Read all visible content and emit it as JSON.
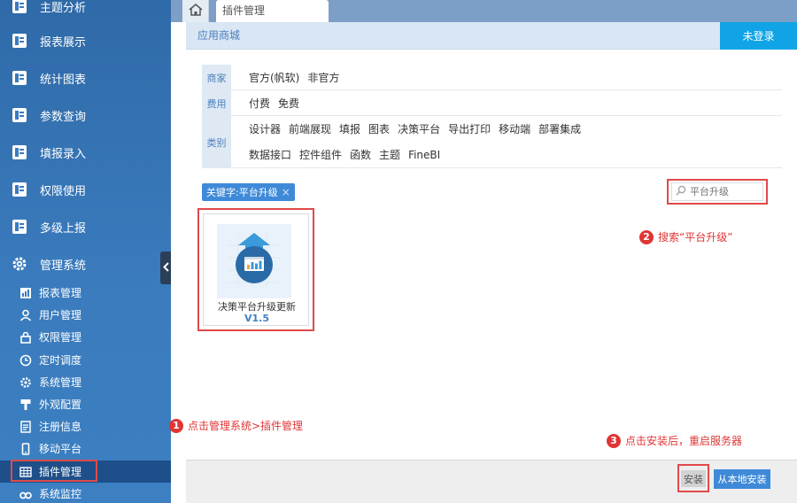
{
  "sidebar": {
    "main_items": [
      {
        "label": "主题分析",
        "icon": "report-icon"
      },
      {
        "label": "报表展示",
        "icon": "report-icon"
      },
      {
        "label": "统计图表",
        "icon": "report-icon"
      },
      {
        "label": "参数查询",
        "icon": "report-icon"
      },
      {
        "label": "填报录入",
        "icon": "report-icon"
      },
      {
        "label": "权限使用",
        "icon": "report-icon"
      },
      {
        "label": "多级上报",
        "icon": "report-icon"
      },
      {
        "label": "管理系统",
        "icon": "gear-icon"
      }
    ],
    "sub_items": [
      {
        "label": "报表管理",
        "icon": "chart-icon"
      },
      {
        "label": "用户管理",
        "icon": "user-icon"
      },
      {
        "label": "权限管理",
        "icon": "lock-icon"
      },
      {
        "label": "定时调度",
        "icon": "clock-icon"
      },
      {
        "label": "系统管理",
        "icon": "gear-icon"
      },
      {
        "label": "外观配置",
        "icon": "brush-icon"
      },
      {
        "label": "注册信息",
        "icon": "document-icon"
      },
      {
        "label": "移动平台",
        "icon": "phone-icon"
      },
      {
        "label": "插件管理",
        "icon": "grid-icon"
      },
      {
        "label": "系统监控",
        "icon": "binoculars-icon"
      }
    ],
    "active_item": "插件管理"
  },
  "tabs": {
    "home_icon": "home-icon",
    "active_tab": "插件管理"
  },
  "header": {
    "title": "应用商城",
    "login_label": "未登录"
  },
  "filters": {
    "vendor_label": "商家",
    "vendor_options": [
      "官方(帆软)",
      "非官方"
    ],
    "fee_label": "费用",
    "fee_options": [
      "付费",
      "免费"
    ],
    "category_label": "类别",
    "category_row1": [
      "设计器",
      "前端展现",
      "填报",
      "图表",
      "决策平台",
      "导出打印",
      "移动端",
      "部署集成"
    ],
    "category_row2": [
      "数据接口",
      "控件组件",
      "函数",
      "主题",
      "FineBI"
    ]
  },
  "keyword_tag": {
    "label": "关键字:平台升级",
    "close": "×"
  },
  "search": {
    "placeholder": "平台升级"
  },
  "plugin": {
    "name": "决策平台升级更新",
    "version": "V1.5"
  },
  "annotations": [
    {
      "num": "1",
      "text": "点击管理系统>插件管理"
    },
    {
      "num": "2",
      "text": "搜索“平台升级”"
    },
    {
      "num": "3",
      "text": "点击安装后，重启服务器"
    }
  ],
  "footer": {
    "install_label": "安装",
    "local_install_label": "从本地安装"
  },
  "colors": {
    "accent": "#10a4e6",
    "highlight": "#e04a4a",
    "sidebar": "#3a7bbd"
  }
}
